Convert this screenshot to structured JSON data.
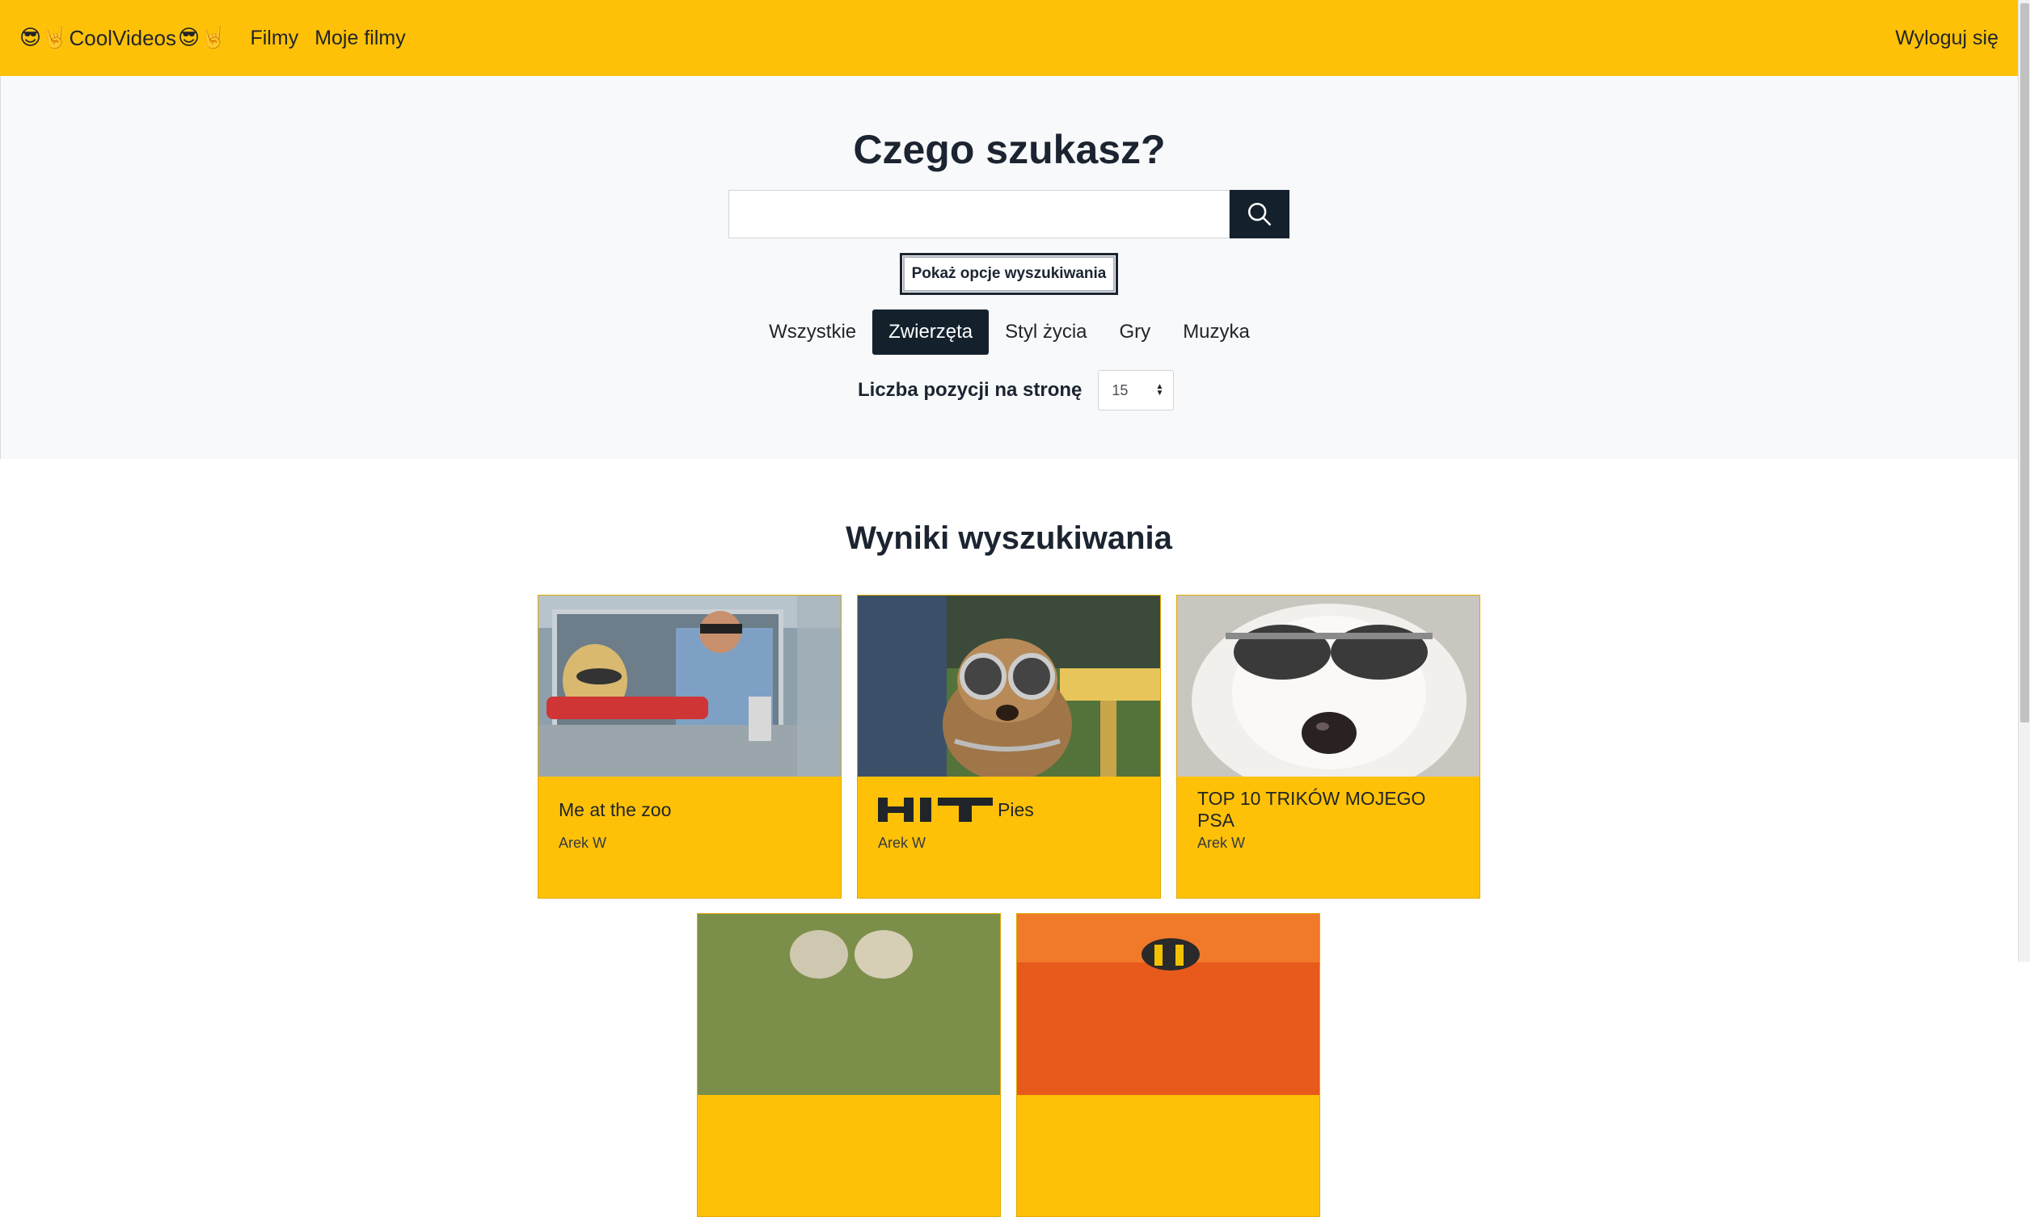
{
  "navbar": {
    "brand_text": "CoolVideos",
    "brand_emoji_left": "😎🤘",
    "brand_emoji_right": "😎🤘",
    "links": [
      {
        "label": "Filmy"
      },
      {
        "label": "Moje filmy"
      }
    ],
    "logout_label": "Wyloguj się"
  },
  "search": {
    "title": "Czego szukasz?",
    "input_value": "",
    "input_placeholder": "",
    "button_icon": "search-icon",
    "options_button_label": "Pokaż opcje wyszukiwania"
  },
  "categories": [
    {
      "label": "Wszystkie",
      "active": false
    },
    {
      "label": "Zwierzęta",
      "active": true
    },
    {
      "label": "Styl życia",
      "active": false
    },
    {
      "label": "Gry",
      "active": false
    },
    {
      "label": "Muzyka",
      "active": false
    }
  ],
  "per_page": {
    "label": "Liczba pozycji na stronę",
    "value": "15"
  },
  "results": {
    "title": "Wyniki wyszukiwania",
    "items": [
      {
        "title": "Me at the zoo",
        "author": "Arek W",
        "hit": false
      },
      {
        "title": "Pies",
        "author": "Arek W",
        "hit": true
      },
      {
        "title": "TOP 10 TRIKÓW MOJEGO PSA",
        "author": "Arek W",
        "hit": false
      }
    ]
  },
  "colors": {
    "accent": "#ffc107",
    "dark": "#14212d",
    "light_bg": "#f8f9fa"
  }
}
